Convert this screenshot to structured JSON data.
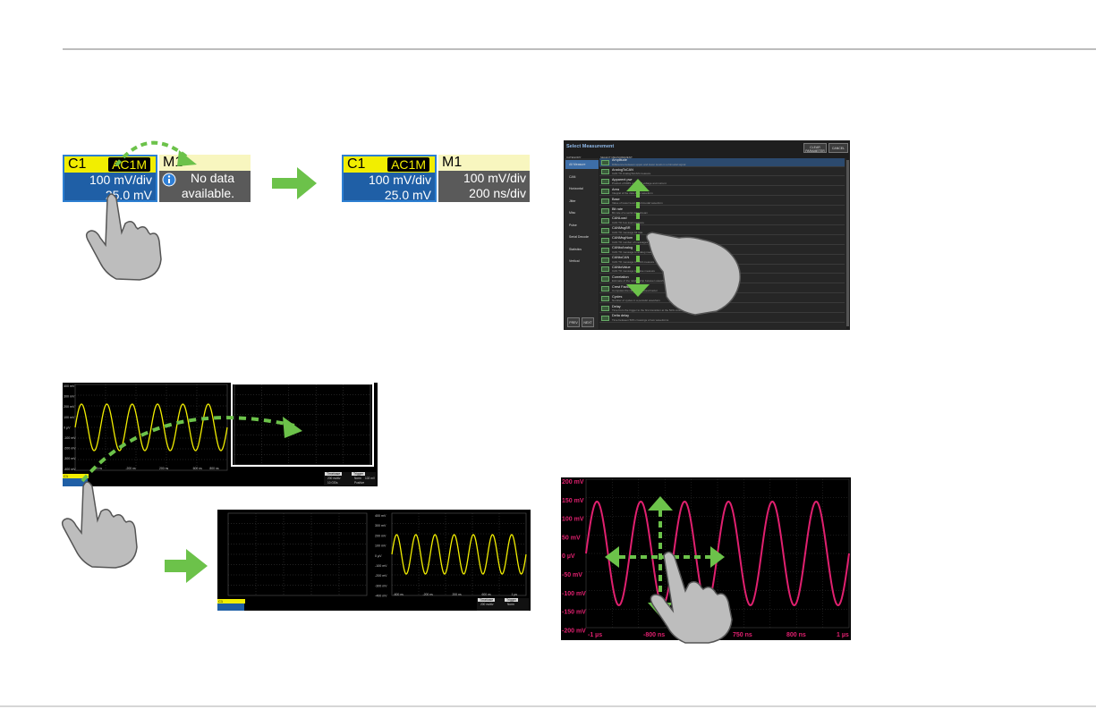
{
  "colors": {
    "accent_green": "#6cc24a",
    "trace_yellow": "#f2ee00",
    "trace_pink": "#e0206f",
    "channel_blue": "#1f5fa6",
    "hand_gray": "#bdbdbd"
  },
  "step1": {
    "before": {
      "c1_label": "C1",
      "c1_badge": "AC1M",
      "c1_vdiv": "100 mV/div",
      "c1_offset": "25.0 mV",
      "m1_label": "M1",
      "m1_line1": "No data",
      "m1_line2": "available."
    },
    "after": {
      "c1_label": "C1",
      "c1_badge": "AC1M",
      "c1_vdiv": "100 mV/div",
      "c1_offset": "25.0 mV",
      "m1_label": "M1",
      "m1_vdiv": "100 mV/div",
      "m1_tdiv": "200 ns/div"
    },
    "icons": [
      "drag-arc-arrow-icon",
      "info-icon",
      "pointing-hand-icon",
      "arrow-right-icon"
    ]
  },
  "select_measurement": {
    "title": "Select Measurement",
    "buttons": [
      "CLEAR PARAMETER",
      "CANCEL"
    ],
    "category_header": "CATEGORY",
    "measurement_header": "SELECT MEASUREMENT",
    "categories": [
      "All Measure",
      "CAN",
      "Horizontal",
      "Jitter",
      "Misc",
      "Pulse",
      "Serial Decode",
      "Statistics",
      "Vertical"
    ],
    "measurements": [
      {
        "name": "Amplitude",
        "desc": "Difference between upper and lower levels in a bimodal signal"
      },
      {
        "name": "AnalogToCAN",
        "desc": "CAN TO AnalogToCAN measure"
      },
      {
        "name": "Apparent pwr",
        "desc": "Product of RMS values of voltage and current"
      },
      {
        "name": "Area",
        "desc": "Integral of the data for a waveform"
      },
      {
        "name": "Base",
        "desc": "Value of lower level of a bimodal waveform"
      },
      {
        "name": "Bit rate",
        "desc": "Bit rate of a serial data stream"
      },
      {
        "name": "CANLoad",
        "desc": "CAN TO bus load measure"
      },
      {
        "name": "CANMsgBR",
        "desc": "CAN TO message bit rate"
      },
      {
        "name": "CANMsgNum",
        "desc": "CAN TO number of messages measure"
      },
      {
        "name": "CANtoAnalog",
        "desc": "CAN TO message to analog measure"
      },
      {
        "name": "CANtoCAN",
        "desc": "CAN TO message to CAN measure"
      },
      {
        "name": "CANtoValue",
        "desc": "CAN TO message to value measure"
      },
      {
        "name": "Correlation",
        "desc": "Estimate of the relationship between waveforms"
      },
      {
        "name": "Crest Factor",
        "desc": "Computes the ratio of the Crest Factor"
      },
      {
        "name": "Cycles",
        "desc": "Number of cycles in a periodic waveform"
      },
      {
        "name": "Delay",
        "desc": "Time from the trigger to the first transition at the 50% crossing"
      },
      {
        "name": "Delta delay",
        "desc": "Time between 50% crossings of two waveforms"
      }
    ],
    "nav_buttons": [
      "PREV",
      "NEXT"
    ]
  },
  "step2": {
    "yellow_grid": {
      "y_labels": [
        "400 mV",
        "300 mV",
        "200 mV",
        "100 mV",
        "0 µV",
        "-100 mV",
        "-200 mV",
        "-300 mV",
        "-400 mV"
      ],
      "x_labels": [
        "-800 ns",
        "-600 ns",
        "-400 ns",
        "-200 ns",
        "0 ns",
        "200 ns",
        "400 ns",
        "600 ns",
        "800 ns",
        "1 µs"
      ],
      "c1_label": "C1",
      "timebase_label": "Timebase",
      "trigger_label": "Trigger",
      "tb_vals": [
        "200 ns/div",
        "50.0 µs",
        "10 GS/s"
      ],
      "tr_vals": [
        "Norm",
        "Edge",
        "Positive"
      ],
      "tr_level": "102 mV"
    }
  },
  "pink_grid": {
    "y_labels": [
      "200 mV",
      "150 mV",
      "100 mV",
      "50 mV",
      "0 µV",
      "-50 mV",
      "-100 mV",
      "-150 mV",
      "-200 mV"
    ],
    "x_labels": [
      "-1 µs",
      "-800 ns",
      "750 ns",
      "800 ns",
      "1 µs"
    ]
  }
}
